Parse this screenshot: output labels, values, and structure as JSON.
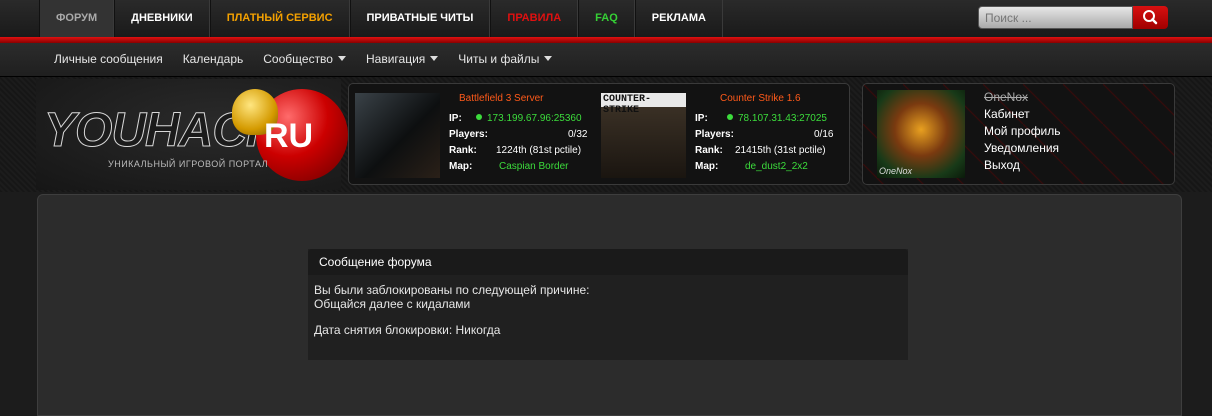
{
  "topnav": {
    "items": [
      {
        "label": "ФОРУМ"
      },
      {
        "label": "ДНЕВНИКИ"
      },
      {
        "label": "ПЛАТНЫЙ СЕРВИС"
      },
      {
        "label": "ПРИВАТНЫЕ ЧИТЫ"
      },
      {
        "label": "ПРАВИЛА"
      },
      {
        "label": "FAQ"
      },
      {
        "label": "РЕКЛАМА"
      }
    ],
    "search_placeholder": "Поиск ..."
  },
  "subnav": {
    "items": [
      {
        "label": "Личные сообщения"
      },
      {
        "label": "Календарь"
      },
      {
        "label": "Сообщество"
      },
      {
        "label": "Навигация"
      },
      {
        "label": "Читы и файлы"
      }
    ]
  },
  "logo": {
    "text": "YOUHACK",
    "tld": "RU",
    "tagline": "УНИКАЛЬНЫЙ ИГРОВОЙ ПОРТАЛ"
  },
  "servers": [
    {
      "name": "Battlefield 3 Server",
      "ip_label": "IP:",
      "ip": "173.199.67.96:25360",
      "players_label": "Players:",
      "players": "0/32",
      "rank_label": "Rank:",
      "rank": "1224th (81st pctile)",
      "map_label": "Map:",
      "map": "Caspian Border"
    },
    {
      "name": "Counter Strike 1.6",
      "thumb_text": "COUNTER-STRIKE",
      "ip_label": "IP:",
      "ip": "78.107.31.43:27025",
      "players_label": "Players:",
      "players": "0/16",
      "rank_label": "Rank:",
      "rank": "21415th (31st pctile)",
      "map_label": "Map:",
      "map": "de_dust2_2x2"
    }
  ],
  "user": {
    "username": "OneNox",
    "avatar_signature": "OneNox",
    "links": [
      "Кабинет",
      "Мой профиль",
      "Уведомления",
      "Выход"
    ]
  },
  "message": {
    "title": "Сообщение форума",
    "line1": "Вы были заблокированы по следующей причине:",
    "line2": "Общайся далее с кидалами",
    "line3": "Дата снятия блокировки: Никогда"
  }
}
